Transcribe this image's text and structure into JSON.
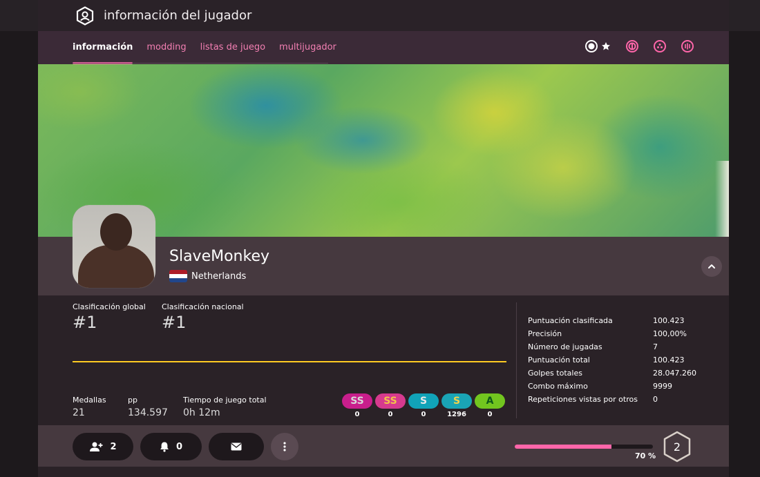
{
  "header": {
    "title": "información del jugador",
    "icon": "user-icon"
  },
  "tabs": [
    {
      "label": "información",
      "active": true
    },
    {
      "label": "modding",
      "active": false
    },
    {
      "label": "listas de juego",
      "active": false
    },
    {
      "label": "multijugador",
      "active": false
    }
  ],
  "mode_icons": [
    "osu-mode-icon",
    "taiko-mode-icon",
    "catch-mode-icon",
    "mania-mode-icon"
  ],
  "profile": {
    "username": "SlaveMonkey",
    "country": "Netherlands"
  },
  "ranks": {
    "global_label": "Clasificación global",
    "global_value": "#1",
    "country_label": "Clasificación nacional",
    "country_value": "#1"
  },
  "summary": {
    "medals_label": "Medallas",
    "medals_value": "21",
    "pp_label": "pp",
    "pp_value": "134.597",
    "playtime_label": "Tiempo de juego total",
    "playtime_value": "0h 12m"
  },
  "grades": [
    {
      "grade": "SS",
      "count": "0",
      "color": "#c81e8c",
      "text_color": "#d8d8d8"
    },
    {
      "grade": "SS",
      "count": "0",
      "color": "#d63a8e",
      "text_color": "#f2c34a"
    },
    {
      "grade": "S",
      "count": "0",
      "color": "#11a3b8",
      "text_color": "#e8e8e8"
    },
    {
      "grade": "S",
      "count": "1296",
      "color": "#1aa4b5",
      "text_color": "#f2d34a"
    },
    {
      "grade": "A",
      "count": "0",
      "color": "#72c51f",
      "text_color": "#0f5a1a"
    }
  ],
  "details": [
    {
      "label": "Puntuación clasificada",
      "value": "100.423"
    },
    {
      "label": "Precisión",
      "value": "100,00%"
    },
    {
      "label": "Número de jugadas",
      "value": "7"
    },
    {
      "label": "Puntuación total",
      "value": "100.423"
    },
    {
      "label": "Golpes totales",
      "value": "28.047.260"
    },
    {
      "label": "Combo máximo",
      "value": "9999"
    },
    {
      "label": "Repeticiones vistas por otros",
      "value": "0"
    }
  ],
  "actions": {
    "friends_count": "2",
    "notifications_count": "0"
  },
  "level": {
    "progress_percent": 70,
    "progress_label": "70 %",
    "value": "2"
  },
  "colors": {
    "accent_pink": "#ff66aa",
    "rank_line": "#ffcc22"
  }
}
